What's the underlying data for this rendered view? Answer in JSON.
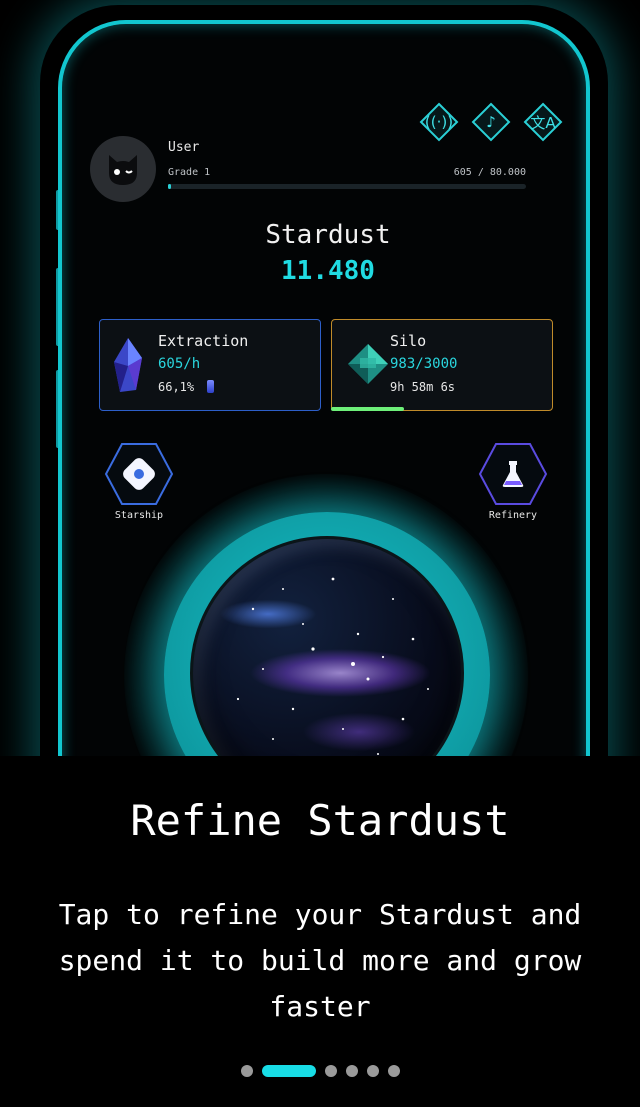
{
  "user": {
    "name": "User",
    "grade": "Grade 1",
    "xp": "605 / 80.000",
    "xp_progress": 0.0076
  },
  "top_icons": [
    "broadcast-icon",
    "music-note-icon",
    "translate-icon"
  ],
  "stardust": {
    "label": "Stardust",
    "value": "11.480"
  },
  "extraction": {
    "title": "Extraction",
    "rate": "605/h",
    "boost": "66,1%"
  },
  "silo": {
    "title": "Silo",
    "capacity": "983/3000",
    "timer": "9h 58m 6s",
    "fill_fraction": 0.33
  },
  "nav": {
    "left_label": "Starship",
    "right_label": "Refinery"
  },
  "onboarding": {
    "title": "Refine Stardust",
    "description": "Tap to refine your Stardust and spend it to build more and grow faster",
    "page_count": 6,
    "active_page": 1
  },
  "colors": {
    "accent": "#18dde6",
    "extraction_border": "#2d5fc9",
    "silo_border": "#c08b2a",
    "progress_green": "#6ef07a"
  }
}
